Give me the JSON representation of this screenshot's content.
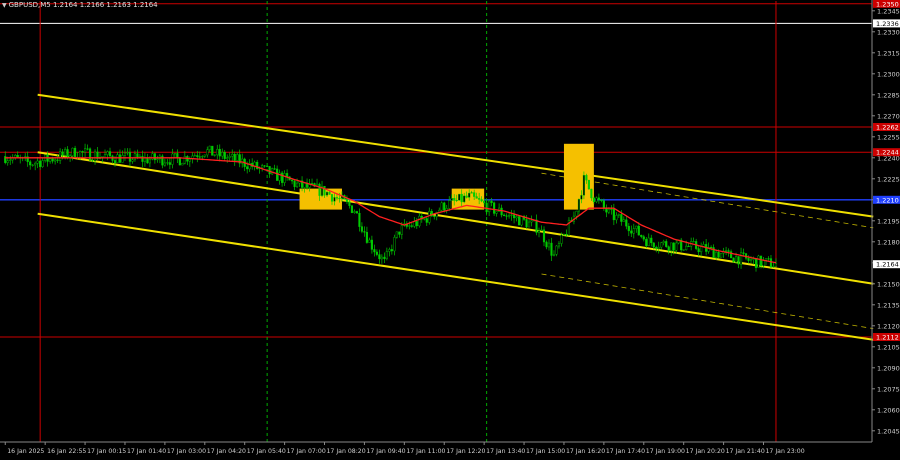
{
  "header": {
    "symbol": "GBPUSD,M5",
    "ohlc": "1.2164 1.2166 1.2163 1.2164"
  },
  "colors": {
    "background": "#000000",
    "candle": "#00cc00",
    "ma": "#ff2020",
    "channel": "#f0e000",
    "level_red": "#cc0000",
    "level_blue": "#2040ff",
    "level_white": "#ffffff",
    "vline_green": "#00aa00",
    "vline_red": "#cc0000",
    "signal_box": "#f5c000",
    "current_price_bg": "#ffffff"
  },
  "chart_data": {
    "type": "candlestick",
    "title": "GBPUSD,M5",
    "ylim": [
      1.2037,
      1.2352
    ],
    "y_ticks": [
      1.2045,
      1.206,
      1.2075,
      1.209,
      1.2105,
      1.212,
      1.2135,
      1.215,
      1.2165,
      1.218,
      1.2195,
      1.221,
      1.2225,
      1.224,
      1.2255,
      1.227,
      1.2285,
      1.23,
      1.2315,
      1.233,
      1.2345
    ],
    "y_tick_labels": [
      "1.2045",
      "1.2060",
      "1.2075",
      "1.2090",
      "1.2105",
      "1.2120",
      "1.2135",
      "1.2150",
      "1.2165",
      "1.2180",
      "1.2195",
      "1.2210",
      "1.2225",
      "1.2240",
      "1.2255",
      "1.2270",
      "1.2285",
      "1.2300",
      "1.2315",
      "1.2330",
      "1.2345"
    ],
    "x_labels": [
      "16 Jan 2025",
      "16 Jan 22:55",
      "17 Jan 00:15",
      "17 Jan 01:40",
      "17 Jan 03:00",
      "17 Jan 04:20",
      "17 Jan 05:40",
      "17 Jan 07:00",
      "17 Jan 08:20",
      "17 Jan 09:40",
      "17 Jan 11:00",
      "17 Jan 12:20",
      "17 Jan 13:40",
      "17 Jan 15:00",
      "17 Jan 16:20",
      "17 Jan 17:40",
      "17 Jan 19:00",
      "17 Jan 20:20",
      "17 Jan 21:40",
      "17 Jan 23:00"
    ],
    "x_label_bars": [
      0,
      16,
      32,
      48,
      64,
      80,
      96,
      112,
      128,
      144,
      160,
      176,
      192,
      208,
      224,
      240,
      256,
      272,
      288,
      304
    ],
    "bar_count": 348,
    "last_price": 1.2164,
    "last_price_label": "1.2164",
    "close_anchors": [
      [
        0,
        1.2241
      ],
      [
        10,
        1.2236
      ],
      [
        20,
        1.224
      ],
      [
        28,
        1.2244
      ],
      [
        40,
        1.2241
      ],
      [
        55,
        1.2239
      ],
      [
        70,
        1.2239
      ],
      [
        80,
        1.2245
      ],
      [
        95,
        1.2237
      ],
      [
        108,
        1.2228
      ],
      [
        118,
        1.222
      ],
      [
        128,
        1.2216
      ],
      [
        135,
        1.2209
      ],
      [
        140,
        1.2203
      ],
      [
        146,
        1.218
      ],
      [
        152,
        1.2165
      ],
      [
        158,
        1.2188
      ],
      [
        168,
        1.2196
      ],
      [
        176,
        1.2206
      ],
      [
        186,
        1.2212
      ],
      [
        196,
        1.2203
      ],
      [
        206,
        1.2196
      ],
      [
        214,
        1.219
      ],
      [
        220,
        1.217
      ],
      [
        228,
        1.2198
      ],
      [
        232,
        1.2224
      ],
      [
        236,
        1.2212
      ],
      [
        242,
        1.22
      ],
      [
        250,
        1.2192
      ],
      [
        258,
        1.218
      ],
      [
        266,
        1.2178
      ],
      [
        278,
        1.2176
      ],
      [
        290,
        1.217
      ],
      [
        300,
        1.2166
      ],
      [
        309,
        1.2164
      ]
    ],
    "ma_anchors": [
      [
        0,
        1.224
      ],
      [
        20,
        1.224
      ],
      [
        40,
        1.224
      ],
      [
        70,
        1.224
      ],
      [
        95,
        1.2237
      ],
      [
        115,
        1.2225
      ],
      [
        128,
        1.2218
      ],
      [
        140,
        1.2209
      ],
      [
        150,
        1.2198
      ],
      [
        160,
        1.2192
      ],
      [
        172,
        1.22
      ],
      [
        185,
        1.2206
      ],
      [
        200,
        1.2202
      ],
      [
        215,
        1.2194
      ],
      [
        225,
        1.2192
      ],
      [
        234,
        1.2204
      ],
      [
        244,
        1.2204
      ],
      [
        255,
        1.2192
      ],
      [
        268,
        1.2182
      ],
      [
        285,
        1.2174
      ],
      [
        309,
        1.2165
      ]
    ],
    "levels": [
      {
        "price": 1.235,
        "label": "1.2350",
        "color": "#cc0000"
      },
      {
        "price": 1.2336,
        "label": "1.2336",
        "color": "#ffffff"
      },
      {
        "price": 1.2262,
        "label": "1.2262",
        "color": "#cc0000"
      },
      {
        "price": 1.2244,
        "label": "1.2244",
        "color": "#cc0000"
      },
      {
        "price": 1.221,
        "label": "1.2210",
        "color": "#2040ff"
      },
      {
        "price": 1.2112,
        "label": "1.2112",
        "color": "#cc0000"
      }
    ],
    "vlines_red_bars": [
      14,
      309
    ],
    "vlines_green_bars": [
      105,
      193
    ],
    "channel_lines": [
      {
        "from": [
          13,
          1.2285
        ],
        "to": [
          348,
          1.2198
        ]
      },
      {
        "from": [
          13,
          1.2244
        ],
        "to": [
          348,
          1.215
        ]
      },
      {
        "from": [
          13,
          1.22
        ],
        "to": [
          348,
          1.211
        ]
      }
    ],
    "channel_dashed": [
      {
        "from": [
          215,
          1.2229
        ],
        "to": [
          348,
          1.219
        ]
      },
      {
        "from": [
          215,
          1.2157
        ],
        "to": [
          348,
          1.2118
        ]
      }
    ],
    "signal_boxes": [
      {
        "bars": [
          118,
          135
        ],
        "prices": [
          1.2203,
          1.2218
        ]
      },
      {
        "bars": [
          179,
          192
        ],
        "prices": [
          1.2203,
          1.2218
        ]
      },
      {
        "bars": [
          224,
          236
        ],
        "prices": [
          1.2203,
          1.225
        ]
      }
    ]
  }
}
